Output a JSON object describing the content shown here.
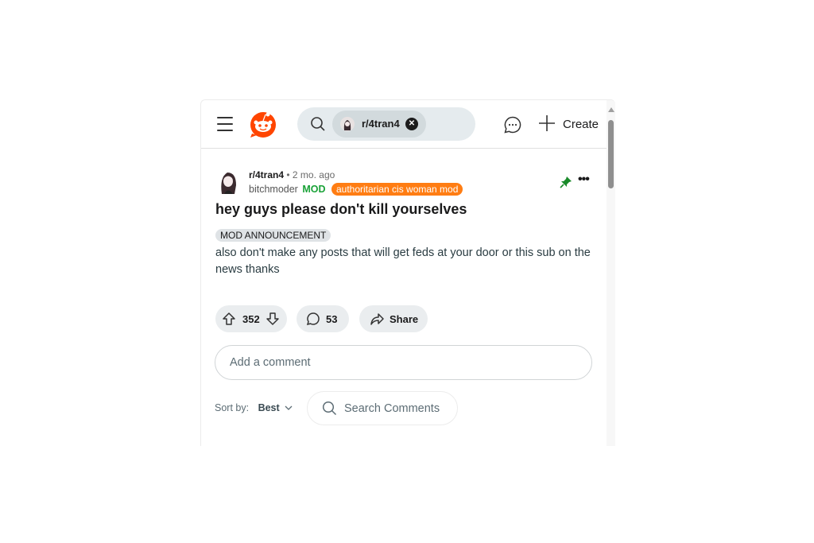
{
  "header": {
    "search_chip_label": "r/4tran4",
    "create_label": "Create",
    "icons": [
      "menu-icon",
      "reddit-logo",
      "search-icon",
      "clear-icon",
      "chat-icon",
      "plus-icon"
    ]
  },
  "post": {
    "subreddit": "r/4tran4",
    "separator": "•",
    "time": "2 mo. ago",
    "author": "bitchmoder",
    "mod_tag": "MOD",
    "user_flair": "authoritarian cis woman mod",
    "title": "hey guys please don't kill yourselves",
    "post_flair": "MOD ANNOUNCEMENT",
    "body": "also don't make any posts that will get feds at your door or this sub on the news thanks",
    "more_label": "•••",
    "score": "352",
    "comment_count": "53",
    "share_label": "Share"
  },
  "comments": {
    "add_placeholder": "Add a comment",
    "sort_label": "Sort by:",
    "sort_value": "Best",
    "search_placeholder": "Search Comments"
  },
  "colors": {
    "brand": "#ff4500",
    "mod_green": "#1aa238",
    "flair_orange": "#ff7d13",
    "pin_green": "#1a8a2a"
  }
}
